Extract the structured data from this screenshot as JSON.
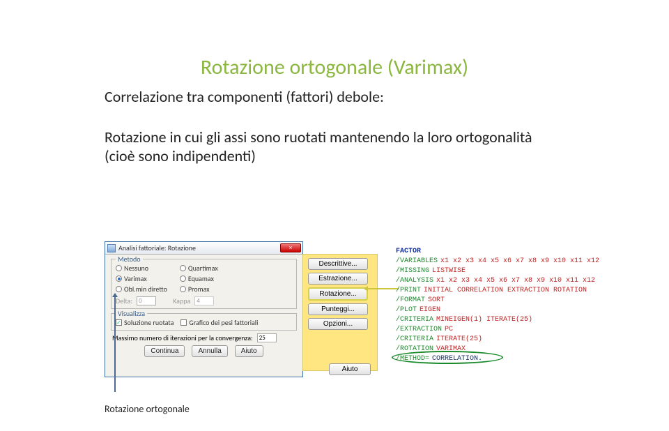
{
  "title": "Rotazione ortogonale (Varimax)",
  "para1": "Correlazione tra componenti (fattori) debole:",
  "para2": "Rotazione in cui gli assi sono ruotati mantenendo la loro ortogonalità (cioè sono indipendenti)",
  "footer": "Rotazione ortogonale",
  "dialog": {
    "title": "Analisi fattoriale: Rotazione",
    "close": "×",
    "group_method": "Metodo",
    "radios_left": [
      "Nessuno",
      "Varimax",
      "Obl.min diretto"
    ],
    "radios_right": [
      "Quartimax",
      "Equamax",
      "Promax"
    ],
    "delta_label": "Delta:",
    "delta_value": "0",
    "kappa_label": "Kappa",
    "kappa_value": "4",
    "group_view": "Visualizza",
    "check_solution": "Soluzione ruotata",
    "check_plot": "Grafico dei pesi fattoriali",
    "iter_label": "Massimo numero di iterazioni per la convergenza:",
    "iter_value": "25",
    "btn_continue": "Continua",
    "btn_cancel": "Annulla",
    "btn_help": "Aiuto"
  },
  "side_buttons": [
    "Descrittive...",
    "Estrazione...",
    "Rotazione...",
    "Punteggi...",
    "Opzioni..."
  ],
  "aiuto": "Aiuto",
  "syntax": {
    "head": "FACTOR",
    "lines": [
      {
        "g": "/VARIABLES",
        "r": "x1 x2 x3 x4 x5 x6 x7 x8 x9 x10 x11 x12"
      },
      {
        "g": "/MISSING",
        "r": "LISTWISE"
      },
      {
        "g": "/ANALYSIS",
        "r": "x1 x2 x3 x4 x5 x6 x7 x8 x9 x10 x11 x12"
      },
      {
        "g": "/PRINT",
        "r": "INITIAL CORRELATION EXTRACTION ROTATION"
      },
      {
        "g": "/FORMAT",
        "r": "SORT"
      },
      {
        "g": "/PLOT",
        "r": "EIGEN"
      },
      {
        "g": "/CRITERIA",
        "r": "MINEIGEN(1) ITERATE(25)"
      },
      {
        "g": "/EXTRACTION",
        "r": "PC"
      },
      {
        "g": "/CRITERIA",
        "r": "ITERATE(25)"
      },
      {
        "g": "/ROTATION",
        "r": "VARIMAX"
      },
      {
        "g": "/METHOD=",
        "r": "CORRELATION."
      }
    ]
  }
}
